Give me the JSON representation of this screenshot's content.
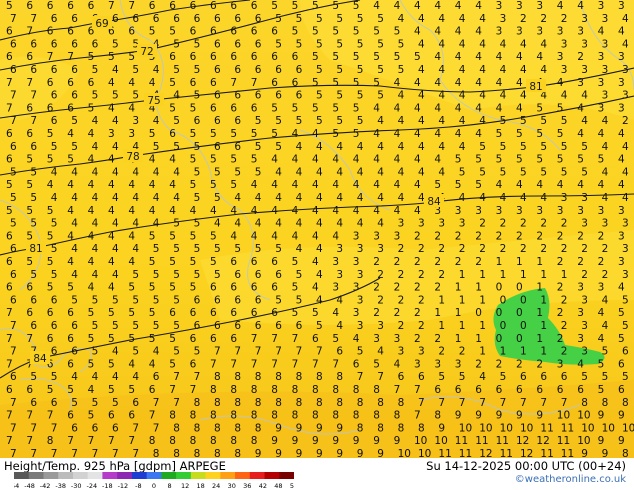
{
  "footer": {
    "title": "Height/Temp. 925 hPa [gdpm] ARPEGE",
    "valid_time": "Su 14-12-2025 00:00 UTC (00+24)",
    "credit": "©weatheronline.co.uk"
  },
  "colorbar": {
    "tick_labels": [
      "-54",
      "-48",
      "-42",
      "-38",
      "-30",
      "-24",
      "-18",
      "-12",
      "-8",
      "0",
      "8",
      "12",
      "18",
      "24",
      "30",
      "36",
      "42",
      "48",
      "54"
    ],
    "colors": [
      "#5a5a5a",
      "#7a7a7a",
      "#9a9a9a",
      "#bcbcbc",
      "#d2d2d2",
      "#e4e4e4",
      "#b43cc8",
      "#8c28b4",
      "#1e3cd2",
      "#3c78f0",
      "#1eaa1e",
      "#32cd32",
      "#c8dc1e",
      "#ffd21e",
      "#ffa014",
      "#ff6414",
      "#e61e1e",
      "#b40000",
      "#780000"
    ]
  },
  "map": {
    "background_colors": {
      "main": "#fbd31f",
      "light": "#fcdd33",
      "bottom": "#f7c61a",
      "green": "#46d046"
    },
    "contour_labels": [
      "69",
      "72",
      "75",
      "78",
      "81",
      "81",
      "84",
      "84"
    ],
    "value_rows": [
      "5 6 6 6 6 7 7 6 6 6 6 6 6 5 5 5 5 5 4 4 4 4 4 4 3 3 3 4 4 3 3",
      "7 7 6 6 6 6 6 6 6 6 6 6 6 5 5 5 5 5 5 4 4 4 4 4 3 2 2 2 3 3 4",
      "6 7 6 6 6 6 6 5 5 6 6 6 6 6 5 5 5 5 5 5 4 4 4 4 3 3 3 3 3 4 4",
      "6 6 6 6 6 5 5 4 5 5 6 6 6 5 5 5 5 5 5 5 4 4 4 4 4 4 4 3 3 3 4",
      "6 6 7 7 5 5 5 5 6 6 6 6 6 6 6 5 5 5 5 5 5 4 4 4 4 4 4 3 2 3 3",
      "6 6 6 6 5 4 5 4 5 5 6 6 6 6 6 5 5 5 5 5 4 4 4 4 4 4 4 3 3 3 3",
      "7 7 6 6 6 4 4 4 5 6 6 7 7 6 6 5 5 5 5 4 4 4 4 4 4 4 4 4 3 3 3",
      "7 7 6 6 5 5 5 4 4 5 6 6 6 6 6 5 5 5 5 4 4 4 4 4 4 4 4 4 4 3 3",
      "7 6 6 6 5 4 4 4 5 5 6 6 6 5 5 5 5 5 4 4 4 4 4 4 4 4 5 5 4 3 3",
      "7 7 6 5 4 4 3 4 5 6 6 6 5 5 5 5 5 5 4 4 4 4 4 4 5 5 5 5 4 4 2",
      "6 6 5 4 4 3 3 5 6 5 5 5 5 5 4 4 5 5 4 4 4 4 4 4 5 5 5 5 4 4 4",
      "6 6 5 5 4 4 4 5 5 5 6 6 5 5 4 4 4 4 4 4 4 4 4 5 5 5 5 5 5 4 4",
      "6 5 5 5 4 4 4 4 4 5 5 5 5 4 4 4 4 4 4 4 4 4 5 5 5 5 5 5 5 5 4",
      "5 5 4 4 4 4 4 4 4 5 5 5 5 4 4 4 4 4 4 4 4 4 5 5 5 5 5 5 5 4 4",
      "5 5 4 4 4 4 4 4 4 5 5 5 4 4 4 4 4 4 4 4 4 5 5 5 4 4 4 4 4 4 4",
      "5 5 4 4 4 4 4 4 4 5 5 4 4 4 4 4 4 4 4 4 4 4 4 4 4 4 4 3 3 4 4",
      "5 5 5 4 4 4 4 4 4 4 4 4 4 4 4 4 4 4 4 4 4 3 3 3 3 3 3 3 3 3 3",
      "5 5 5 4 4 4 4 4 5 5 4 4 4 4 4 4 4 4 4 3 3 3 3 2 2 2 2 2 3 3 3",
      "6 5 5 4 4 4 4 5 5 5 5 4 4 4 4 4 4 3 3 3 2 2 2 2 2 2 2 2 2 2 3",
      "6 5 5 4 4 4 4 5 5 5 5 5 5 5 4 4 3 3 3 2 2 2 2 2 2 2 2 2 2 2 3",
      "6 5 5 4 4 4 4 5 5 5 5 6 6 6 5 4 3 3 2 2 2 2 2 2 1 1 1 2 2 2 3",
      "6 5 5 4 4 4 5 5 5 5 5 6 6 6 5 4 3 3 2 2 2 2 1 1 1 1 1 1 2 2 3",
      "6 6 5 5 4 4 5 5 5 5 6 6 6 6 5 4 3 3 2 2 2 2 1 1 0 0 1 2 3 3 4",
      "6 6 6 5 5 5 5 5 5 6 6 6 6 5 5 4 4 3 2 2 2 1 1 1 0 0 1 2 3 4 5",
      "7 6 6 6 5 5 5 5 6 6 6 6 6 6 5 5 4 3 2 2 2 1 1 0 0 0 1 2 3 4 5",
      "7 6 6 6 5 5 5 5 5 6 6 6 6 6 6 5 4 3 3 2 2 1 1 1 0 0 1 2 3 4 5",
      "7 7 6 6 5 5 5 5 5 6 6 6 7 7 7 6 5 4 3 3 2 2 1 1 0 0 1 2 3 4 5",
      "7 7 6 6 5 4 5 4 5 5 7 7 7 7 7 7 6 5 4 3 3 2 2 1 1 1 1 2 3 5 6",
      "7 7 6 6 5 5 4 4 5 6 7 7 7 7 7 7 7 6 5 4 3 3 3 2 2 2 2 3 4 5 6",
      "6 5 5 4 4 4 4 6 7 7 8 8 8 8 8 8 8 7 7 6 6 5 5 4 5 6 6 6 5 5 5",
      "6 6 5 5 4 5 5 6 7 7 8 8 8 8 8 8 8 8 8 7 7 6 6 6 6 6 6 6 6 5 6",
      "7 6 6 5 5 5 6 7 7 8 8 8 8 8 8 8 8 8 8 8 7 7 7 7 7 7 7 7 8 8 8",
      "7 7 7 6 5 6 6 7 8 8 8 8 8 8 8 8 8 8 8 8 7 8 9 9 9 9 9 10 10 9 9",
      "7 7 7 6 6 6 7 7 8 8 8 8 8 9 9 9 9 8 8 8 8 9 10 10 10 10 11 11 10 10 10",
      "7 7 8 7 7 7 7 8 8 8 8 8 8 9 9 9 9 9 9 9 10 10 11 11 11 12 12 11 10 9 9",
      "7 7 7 7 7 7 7 8 8 8 8 8 9 9 9 9 9 9 9 10 10 11 11 12 11 12 11 11 9 9 8"
    ]
  }
}
